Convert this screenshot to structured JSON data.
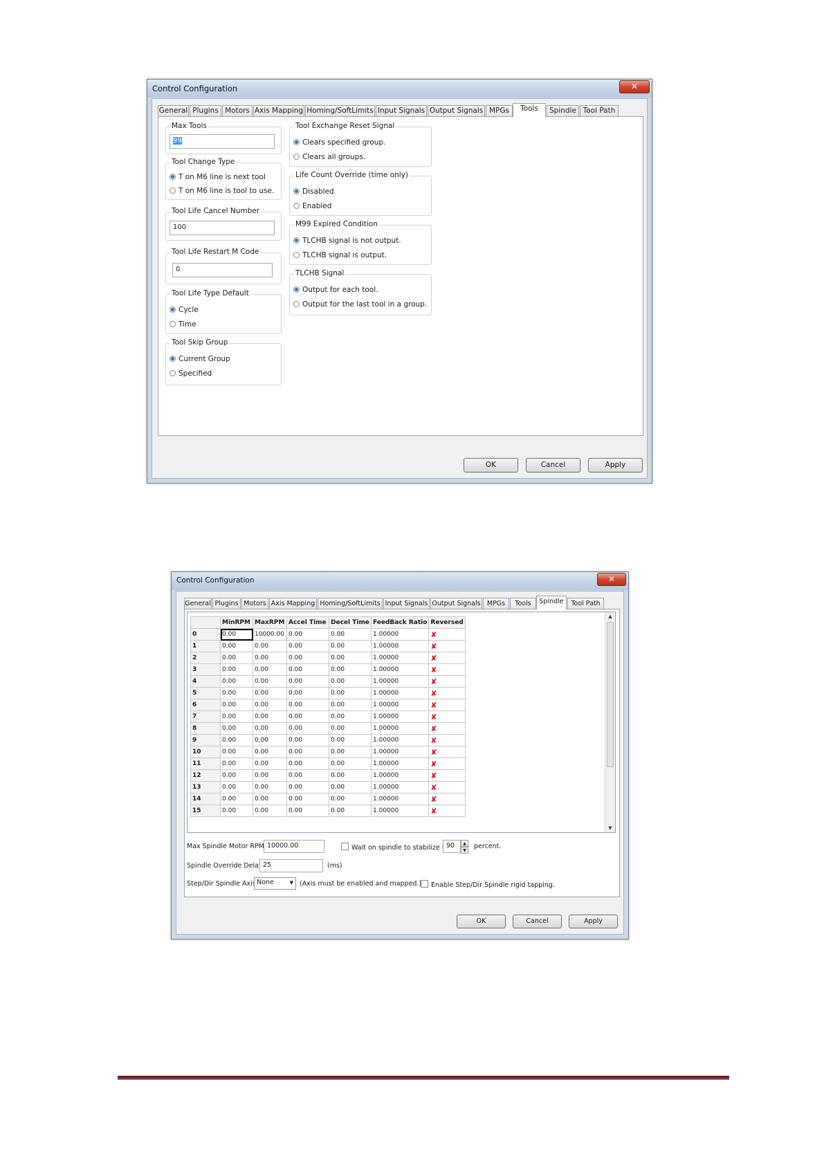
{
  "dialog1": {
    "title": "Control Configuration",
    "close": "✕",
    "tabs": [
      "General",
      "Plugins",
      "Motors",
      "Axis Mapping",
      "Homing/SoftLimits",
      "Input Signals",
      "Output Signals",
      "MPGs",
      "Tools",
      "Spindle",
      "Tool Path"
    ],
    "active_tab": "Tools",
    "max_tools": {
      "label": "Max Tools",
      "value": "99"
    },
    "tool_change_type": {
      "label": "Tool Change Type",
      "options": [
        "T on M6 line is next tool",
        "T on M6 line is tool to use."
      ],
      "selected": 0
    },
    "tool_life_cancel": {
      "label": "Tool Life Cancel Number",
      "value": "100"
    },
    "tool_life_restart": {
      "label": "Tool Life Restart M Code",
      "value": "0"
    },
    "tool_life_type": {
      "label": "Tool Life Type Default",
      "options": [
        "Cycle",
        "Time"
      ],
      "selected": 0
    },
    "tool_skip_group": {
      "label": "Tool Skip Group",
      "options": [
        "Current Group",
        "Specified"
      ],
      "selected": 0
    },
    "tool_exchange_reset": {
      "label": "Tool Exchange Reset Signal",
      "options": [
        "Clears specified group.",
        "Clears all groups."
      ],
      "selected": 0
    },
    "life_count_override": {
      "label": "Life Count Override (time only)",
      "options": [
        "Disabled",
        "Enabled"
      ],
      "selected": 0
    },
    "m99_expired": {
      "label": "M99 Expired Condition",
      "options": [
        "TLCHB signal is not output.",
        "TLCHB signal is output."
      ],
      "selected": 0
    },
    "tlchb_signal": {
      "label": "TLCHB Signal",
      "options": [
        "Output for each tool.",
        "Output for the last tool in a group."
      ],
      "selected": 0
    },
    "buttons": {
      "ok": "OK",
      "cancel": "Cancel",
      "apply": "Apply"
    }
  },
  "dialog2": {
    "title": "Control Configuration",
    "close": "✕",
    "tabs": [
      "General",
      "Plugins",
      "Motors",
      "Axis Mapping",
      "Homing/SoftLimits",
      "Input Signals",
      "Output Signals",
      "MPGs",
      "Tools",
      "Spindle",
      "Tool Path"
    ],
    "active_tab": "Spindle",
    "table": {
      "columns": [
        "",
        "MinRPM",
        "MaxRPM",
        "Accel Time",
        "Decel Time",
        "FeedBack Ratio",
        "Reversed"
      ],
      "rows": [
        [
          "0",
          "0.00",
          "10000.00",
          "0.00",
          "0.00",
          "1.00000",
          "✘"
        ],
        [
          "1",
          "0.00",
          "0.00",
          "0.00",
          "0.00",
          "1.00000",
          "✘"
        ],
        [
          "2",
          "0.00",
          "0.00",
          "0.00",
          "0.00",
          "1.00000",
          "✘"
        ],
        [
          "3",
          "0.00",
          "0.00",
          "0.00",
          "0.00",
          "1.00000",
          "✘"
        ],
        [
          "4",
          "0.00",
          "0.00",
          "0.00",
          "0.00",
          "1.00000",
          "✘"
        ],
        [
          "5",
          "0.00",
          "0.00",
          "0.00",
          "0.00",
          "1.00000",
          "✘"
        ],
        [
          "6",
          "0.00",
          "0.00",
          "0.00",
          "0.00",
          "1.00000",
          "✘"
        ],
        [
          "7",
          "0.00",
          "0.00",
          "0.00",
          "0.00",
          "1.00000",
          "✘"
        ],
        [
          "8",
          "0.00",
          "0.00",
          "0.00",
          "0.00",
          "1.00000",
          "✘"
        ],
        [
          "9",
          "0.00",
          "0.00",
          "0.00",
          "0.00",
          "1.00000",
          "✘"
        ],
        [
          "10",
          "0.00",
          "0.00",
          "0.00",
          "0.00",
          "1.00000",
          "✘"
        ],
        [
          "11",
          "0.00",
          "0.00",
          "0.00",
          "0.00",
          "1.00000",
          "✘"
        ],
        [
          "12",
          "0.00",
          "0.00",
          "0.00",
          "0.00",
          "1.00000",
          "✘"
        ],
        [
          "13",
          "0.00",
          "0.00",
          "0.00",
          "0.00",
          "1.00000",
          "✘"
        ],
        [
          "14",
          "0.00",
          "0.00",
          "0.00",
          "0.00",
          "1.00000",
          "✘"
        ],
        [
          "15",
          "0.00",
          "0.00",
          "0.00",
          "0.00",
          "1.00000",
          "✘"
        ]
      ]
    },
    "max_rpm": {
      "label": "Max Spindle Motor RPM:",
      "value": "10000.00"
    },
    "wait_stabilize": {
      "label": "Wait on spindle to stabilize to",
      "value": "90",
      "suffix": "percent."
    },
    "override_delay": {
      "label": "Spindle Override Delay:",
      "value": "25",
      "unit": "(ms)"
    },
    "step_dir_axis": {
      "label": "Step/Dir Spindle Axis:",
      "value": "None",
      "note": "(Axis must be enabled and mapped.)"
    },
    "rigid_tapping": {
      "label": "Enable Step/Dir Spindle rigid tapping."
    },
    "buttons": {
      "ok": "OK",
      "cancel": "Cancel",
      "apply": "Apply"
    }
  }
}
